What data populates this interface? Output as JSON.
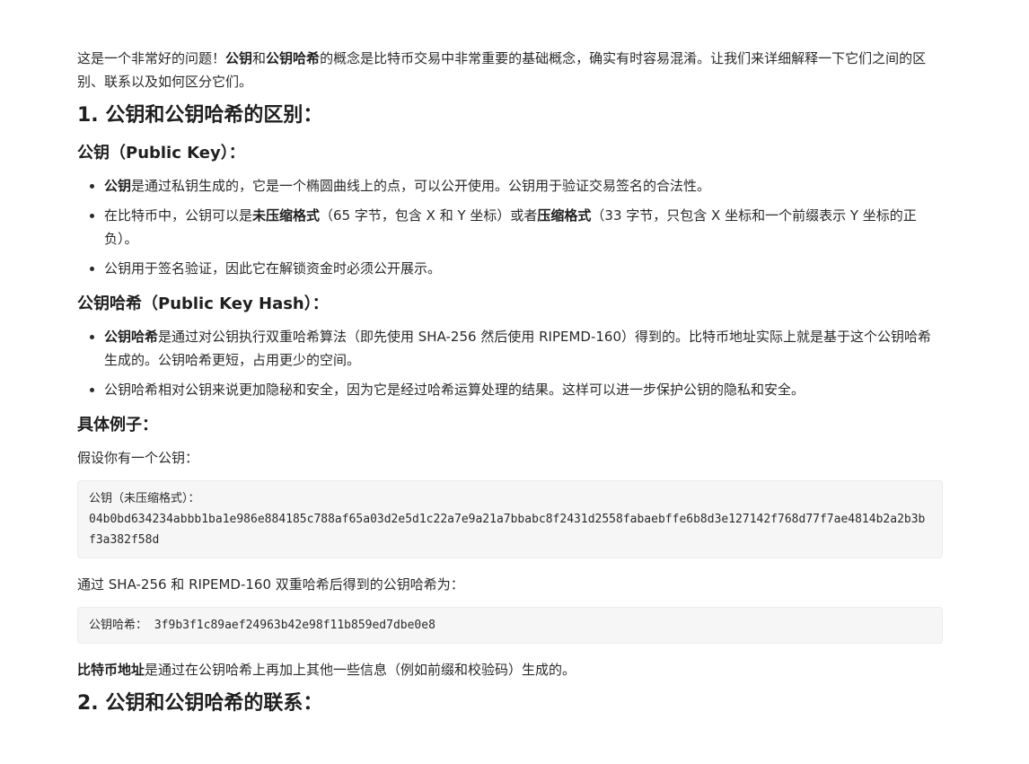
{
  "intro": {
    "p1": "这是一个非常好的问题！",
    "b1": "公钥",
    "p2": "和",
    "b2": "公钥哈希",
    "p3": "的概念是比特币交易中非常重要的基础概念，确实有时容易混淆。让我们来详细解释一下它们之间的区别、联系以及如何区分它们。"
  },
  "section1": {
    "title": "1. 公钥和公钥哈希的区别："
  },
  "public_key": {
    "title": "公钥（Public Key）：",
    "items": [
      {
        "bold": "公钥",
        "text": "是通过私钥生成的，它是一个椭圆曲线上的点，可以公开使用。公钥用于验证交易签名的合法性。"
      },
      {
        "t1": "在比特币中，公钥可以是",
        "b1": "未压缩格式",
        "t2": "（65 字节，包含 X 和 Y 坐标）或者",
        "b2": "压缩格式",
        "t3": "（33 字节，只包含 X 坐标和一个前缀表示 Y 坐标的正负）。"
      },
      {
        "text": "公钥用于签名验证，因此它在解锁资金时必须公开展示。"
      }
    ]
  },
  "public_key_hash": {
    "title": "公钥哈希（Public Key Hash）：",
    "items": [
      {
        "bold": "公钥哈希",
        "text": "是通过对公钥执行双重哈希算法（即先使用 SHA-256 然后使用 RIPEMD-160）得到的。比特币地址实际上就是基于这个公钥哈希生成的。公钥哈希更短，占用更少的空间。"
      },
      {
        "text": "公钥哈希相对公钥来说更加隐秘和安全，因为它是经过哈希运算处理的结果。这样可以进一步保护公钥的隐私和安全。"
      }
    ]
  },
  "example": {
    "title": "具体例子：",
    "intro": "假设你有一个公钥：",
    "code1_label": "公钥（未压缩格式）：",
    "code1_value": "04b0bd634234abbb1ba1e986e884185c788af65a03d2e5d1c22a7e9a21a7bbabc8f2431d2558fabaebffe6b8d3e127142f768d77f7ae4814b2a2b3bf3a382f58d",
    "middle": "通过 SHA-256 和 RIPEMD-160 双重哈希后得到的公钥哈希为：",
    "code2_label": "公钥哈希：",
    "code2_value": " 3f9b3f1c89aef24963b42e98f11b859ed7dbe0e8",
    "address_bold": "比特币地址",
    "address_text": "是通过在公钥哈希上再加上其他一些信息（例如前缀和校验码）生成的。"
  },
  "section2": {
    "title": "2. 公钥和公钥哈希的联系："
  }
}
